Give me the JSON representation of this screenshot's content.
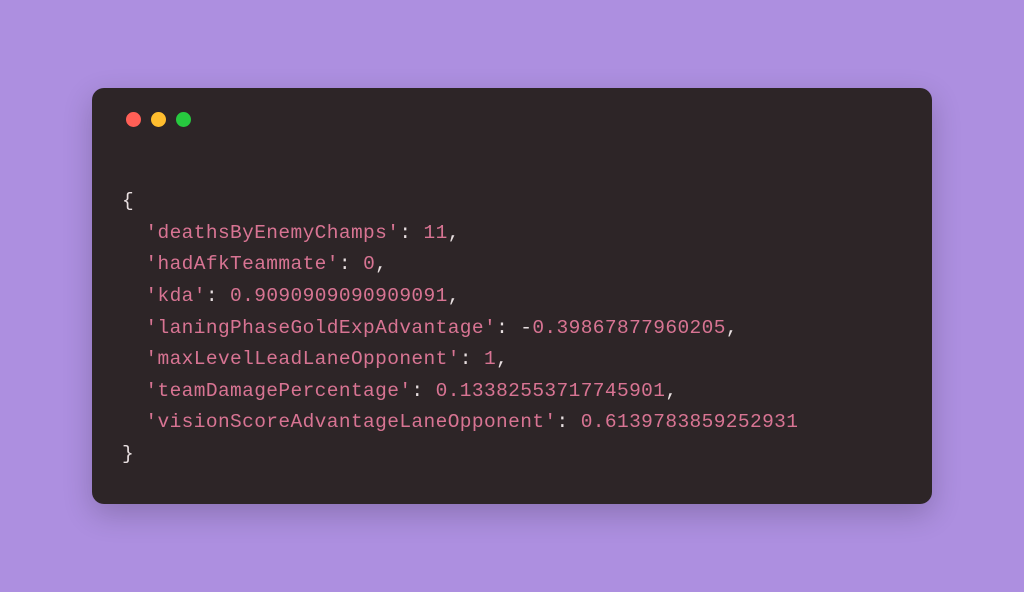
{
  "colors": {
    "background": "#ad8fe0",
    "window_bg": "#2d2527",
    "text": "#e8dfe0",
    "key_color": "#d87493",
    "num_color": "#d87493",
    "tl_red": "#ff5f56",
    "tl_yellow": "#ffbd2e",
    "tl_green": "#27c93f"
  },
  "code": {
    "open": "{",
    "close": "}",
    "entries": [
      {
        "key": "'deathsByEnemyChamps'",
        "sep": ": ",
        "neg": "",
        "value": "11",
        "comma": ","
      },
      {
        "key": "'hadAfkTeammate'",
        "sep": ": ",
        "neg": "",
        "value": "0",
        "comma": ","
      },
      {
        "key": "'kda'",
        "sep": ": ",
        "neg": "",
        "value": "0.9090909090909091",
        "comma": ","
      },
      {
        "key": "'laningPhaseGoldExpAdvantage'",
        "sep": ": ",
        "neg": "-",
        "value": "0.39867877960205",
        "comma": ","
      },
      {
        "key": "'maxLevelLeadLaneOpponent'",
        "sep": ": ",
        "neg": "",
        "value": "1",
        "comma": ","
      },
      {
        "key": "'teamDamagePercentage'",
        "sep": ": ",
        "neg": "",
        "value": "0.13382553717745901",
        "comma": ","
      },
      {
        "key": "'visionScoreAdvantageLaneOpponent'",
        "sep": ": ",
        "neg": "",
        "value": "0.6139783859252931",
        "comma": ""
      }
    ]
  }
}
